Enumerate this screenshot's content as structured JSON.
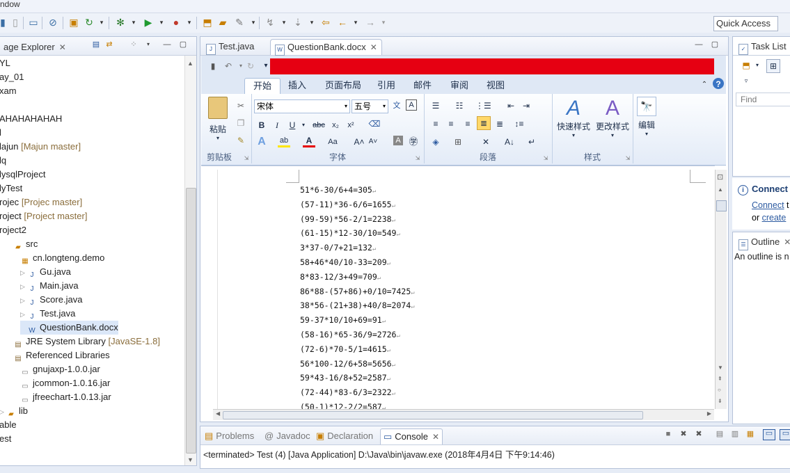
{
  "menubar": {
    "window_menu": "ndow"
  },
  "quick_access": "Quick Access",
  "package_explorer": {
    "title": "age Explorer",
    "items": [
      {
        "label": "YL",
        "extra": ""
      },
      {
        "label": "ay_01",
        "extra": ""
      },
      {
        "label": "xam",
        "extra": ""
      },
      {
        "label": "",
        "extra": ""
      },
      {
        "label": "AHAHAHAHAH",
        "extra": ""
      },
      {
        "label": "l",
        "extra": ""
      },
      {
        "label": "lajun",
        "extra": "[Majun master]"
      },
      {
        "label": "lq",
        "extra": ""
      },
      {
        "label": "lysqlProject",
        "extra": ""
      },
      {
        "label": "lyTest",
        "extra": ""
      },
      {
        "label": "rojec",
        "extra": "[Projec master]"
      },
      {
        "label": "roject",
        "extra": "[Project master]"
      },
      {
        "label": "roject2",
        "extra": ""
      },
      {
        "label": "src",
        "extra": ""
      },
      {
        "label": "cn.longteng.demo",
        "extra": ""
      },
      {
        "label": "Gu.java",
        "extra": ""
      },
      {
        "label": "Main.java",
        "extra": ""
      },
      {
        "label": "Score.java",
        "extra": ""
      },
      {
        "label": "Test.java",
        "extra": ""
      },
      {
        "label": "QuestionBank.docx",
        "extra": ""
      },
      {
        "label": "JRE System Library",
        "extra": "[JavaSE-1.8]"
      },
      {
        "label": "Referenced Libraries",
        "extra": ""
      },
      {
        "label": "gnujaxp-1.0.0.jar",
        "extra": ""
      },
      {
        "label": "jcommon-1.0.16.jar",
        "extra": ""
      },
      {
        "label": "jfreechart-1.0.13.jar",
        "extra": ""
      },
      {
        "label": "lib",
        "extra": ""
      },
      {
        "label": "able",
        "extra": ""
      },
      {
        "label": "est",
        "extra": ""
      }
    ]
  },
  "editor": {
    "tabs": [
      "Test.java",
      "QuestionBank.docx"
    ],
    "ribbon_tabs": [
      "开始",
      "插入",
      "页面布局",
      "引用",
      "邮件",
      "审阅",
      "视图"
    ],
    "font_name": "宋体",
    "font_size": "五号",
    "groups": {
      "clipboard": "剪贴板",
      "paste": "粘贴",
      "font": "字体",
      "paragraph": "段落",
      "styles": "样式",
      "quick_styles": "快速样式",
      "change_styles": "更改样式",
      "edit": "编辑"
    },
    "lines": [
      "51*6-30/6+4=305",
      "(57-11)*36-6/6=1655",
      "(99-59)*56-2/1=2238",
      "(61-15)*12-30/10=549",
      "3*37-0/7+21=132",
      "58+46*40/10-33=209",
      "8*83-12/3+49=709",
      "86*88-(57+86)+0/10=7425",
      "38*56-(21+38)+40/8=2074",
      "59-37*10/10+69=91",
      "(58-16)*65-36/9=2726",
      "(72-6)*70-5/1=4615",
      "56*100-12/6+58=5656",
      "59*43-16/8+52=2587",
      "(72-44)*83-6/3=2322",
      "(50-1)*12-2/2=587"
    ]
  },
  "task_list": {
    "title": "Task List",
    "find_placeholder": "Find"
  },
  "connect": {
    "title": "Connect",
    "link1": "Connect",
    "text1": "t",
    "or": "or",
    "link2": "create"
  },
  "outline": {
    "title": "Outline",
    "message": "An outline is n"
  },
  "bottom_tabs": [
    "Problems",
    "Javadoc",
    "Declaration",
    "Console"
  ],
  "console_text": "<terminated> Test (4) [Java Application] D:\\Java\\bin\\javaw.exe (2018年4月4日 下午9:14:46)"
}
